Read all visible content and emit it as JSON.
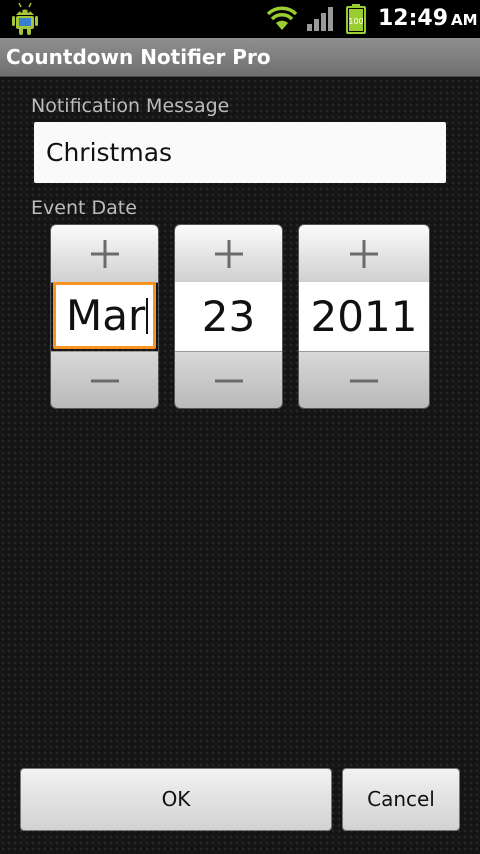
{
  "status_bar": {
    "time": "12:49",
    "ampm": "AM",
    "battery_level": "100",
    "icons": [
      "android-notification-icon",
      "wifi-icon",
      "signal-icon",
      "battery-icon"
    ]
  },
  "app": {
    "title": "Countdown Notifier Pro"
  },
  "form": {
    "message_label": "Notification Message",
    "message_value": "Christmas",
    "date_label": "Event Date",
    "date": {
      "month": "Mar",
      "day": "23",
      "year": "2011"
    }
  },
  "actions": {
    "ok_label": "OK",
    "cancel_label": "Cancel"
  },
  "colors": {
    "focus": "#f7931e",
    "title_bar": "#808080",
    "wifi": "#9acd32"
  }
}
